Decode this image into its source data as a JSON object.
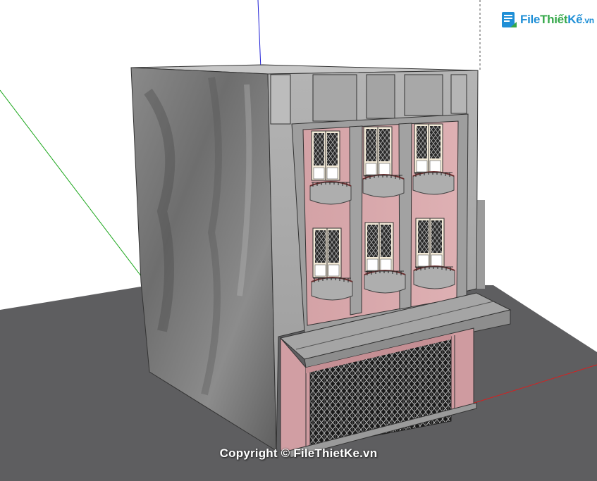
{
  "logo": {
    "file": "File",
    "thiet": "Thiết",
    "ke": "Kế",
    "domain": ".vn"
  },
  "watermark": {
    "copyright": "Copyright © FileThietKe.vn"
  },
  "colors": {
    "ground": "#5e5e60",
    "concrete": "#7f7f7f",
    "pink_wall": "#d7a4a8",
    "facade_gray": "#a9a9ab",
    "axis_green": "#1aa61a",
    "axis_blue": "#1d1dd6",
    "axis_red": "#d62020"
  },
  "icons": [
    "logo-mark-icon"
  ]
}
